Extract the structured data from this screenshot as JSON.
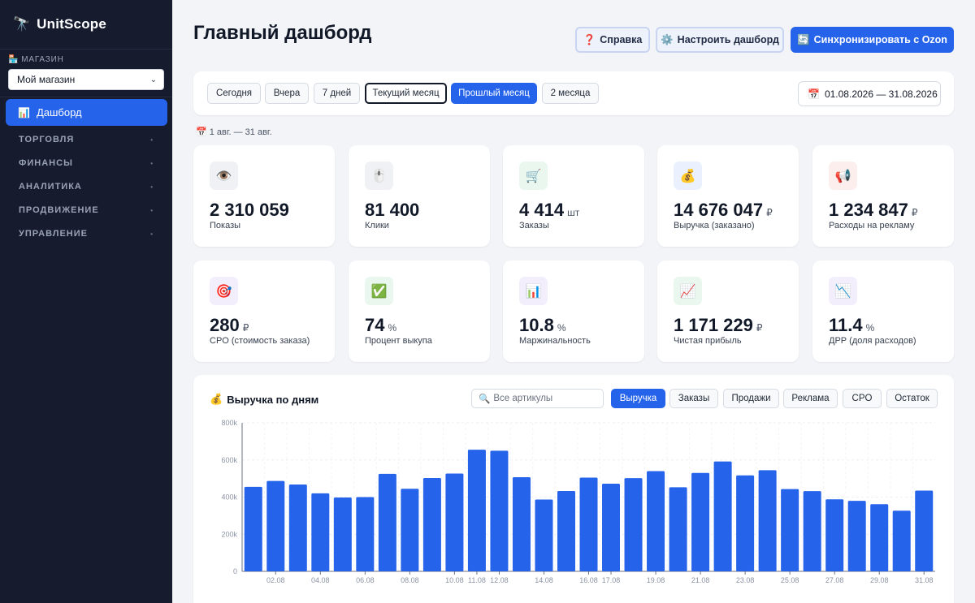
{
  "sidebar": {
    "logo_icon": "telescope-icon",
    "brand": "UnitScope",
    "store_label": "МАГАЗИН",
    "store_icon": "store-icon",
    "store_selected": "Мой магазин",
    "active_item": {
      "icon": "bar-chart-icon",
      "label": "Дашборд"
    },
    "sections": [
      "ТОРГОВЛЯ",
      "ФИНАНСЫ",
      "АНАЛИТИКА",
      "ПРОДВИЖЕНИЕ",
      "УПРАВЛЕНИЕ"
    ]
  },
  "header": {
    "title": "Главный дашборд",
    "help_button": "Справка",
    "customize_button": "Настроить дашборд",
    "sync_button": "Синхронизировать с Ozon"
  },
  "period": {
    "buttons": [
      "Сегодня",
      "Вчера",
      "7 дней",
      "Текущий месяц",
      "Прошлый месяц",
      "2 месяца"
    ],
    "active": "Прошлый месяц",
    "date_range": "01.08.2026 — 31.08.2026",
    "range_note": "1 авг. — 31 авг."
  },
  "kpis": [
    {
      "icon": "eye-icon",
      "value": "2 310 059",
      "unit": "",
      "label": "Показы",
      "bg": "#f0f1f5"
    },
    {
      "icon": "mouse-icon",
      "value": "81 400",
      "unit": "",
      "label": "Клики",
      "bg": "#f0f1f5"
    },
    {
      "icon": "cart-icon",
      "value": "4 414",
      "unit": "шт",
      "label": "Заказы",
      "bg": "#e9f7ef"
    },
    {
      "icon": "money-bag-icon",
      "value": "14 676 047",
      "unit": "₽",
      "label": "Выручка (заказано)",
      "bg": "#eaf0fd"
    },
    {
      "icon": "megaphone-icon",
      "value": "1 234 847",
      "unit": "₽",
      "label": "Расходы на рекламу",
      "bg": "#fdeeee"
    },
    {
      "icon": "target-icon",
      "value": "280",
      "unit": "₽",
      "label": "CPO (стоимость заказа)",
      "bg": "#f3eefc"
    },
    {
      "icon": "check-icon",
      "value": "74",
      "unit": "%",
      "label": "Процент выкупа",
      "bg": "#e9f7ef"
    },
    {
      "icon": "bar-chart-icon",
      "value": "10.8",
      "unit": "%",
      "label": "Маржинальность",
      "bg": "#f3eefc"
    },
    {
      "icon": "trend-up-icon",
      "value": "1 171 229",
      "unit": "₽",
      "label": "Чистая прибыль",
      "bg": "#e9f7ef"
    },
    {
      "icon": "trend-down-icon",
      "value": "11.4",
      "unit": "%",
      "label": "ДРР (доля расходов)",
      "bg": "#f3eefc"
    }
  ],
  "chart": {
    "title": "Выручка по дням",
    "title_icon": "money-bag-icon",
    "search_placeholder": "Все артикулы",
    "tabs": [
      "Выручка",
      "Заказы",
      "Продажи",
      "Реклама",
      "CPO",
      "Остаток"
    ],
    "active_tab": "Выручка"
  },
  "chart_data": {
    "type": "bar",
    "bar_color": "#2563eb",
    "categories": [
      "01.08",
      "02.08",
      "03.08",
      "04.08",
      "05.08",
      "06.08",
      "07.08",
      "08.08",
      "09.08",
      "10.08",
      "11.08",
      "12.08",
      "13.08",
      "14.08",
      "15.08",
      "16.08",
      "17.08",
      "18.08",
      "19.08",
      "20.08",
      "21.08",
      "22.08",
      "23.08",
      "24.08",
      "25.08",
      "26.08",
      "27.08",
      "28.08",
      "29.08",
      "30.08",
      "31.08"
    ],
    "shown_tick_labels": [
      "02.08",
      "04.08",
      "06.08",
      "08.08",
      "10.08",
      "11.08",
      "12.08",
      "14.08",
      "16.08",
      "17.08",
      "19.08",
      "21.08",
      "23.08",
      "25.08",
      "27.08",
      "29.08",
      "31.08"
    ],
    "values": [
      455000,
      487000,
      468000,
      420000,
      398000,
      400000,
      525000,
      445000,
      503000,
      527000,
      655000,
      650000,
      507000,
      387000,
      433000,
      505000,
      472000,
      502000,
      540000,
      453000,
      530000,
      592000,
      517000,
      545000,
      443000,
      432000,
      388000,
      380000,
      362000,
      327000,
      435000
    ],
    "ylim": [
      0,
      800000
    ],
    "yticks": [
      0,
      200000,
      400000,
      600000,
      800000
    ],
    "ytick_labels": [
      "0",
      "200k",
      "400k",
      "600k",
      "800k"
    ],
    "grid": true
  }
}
